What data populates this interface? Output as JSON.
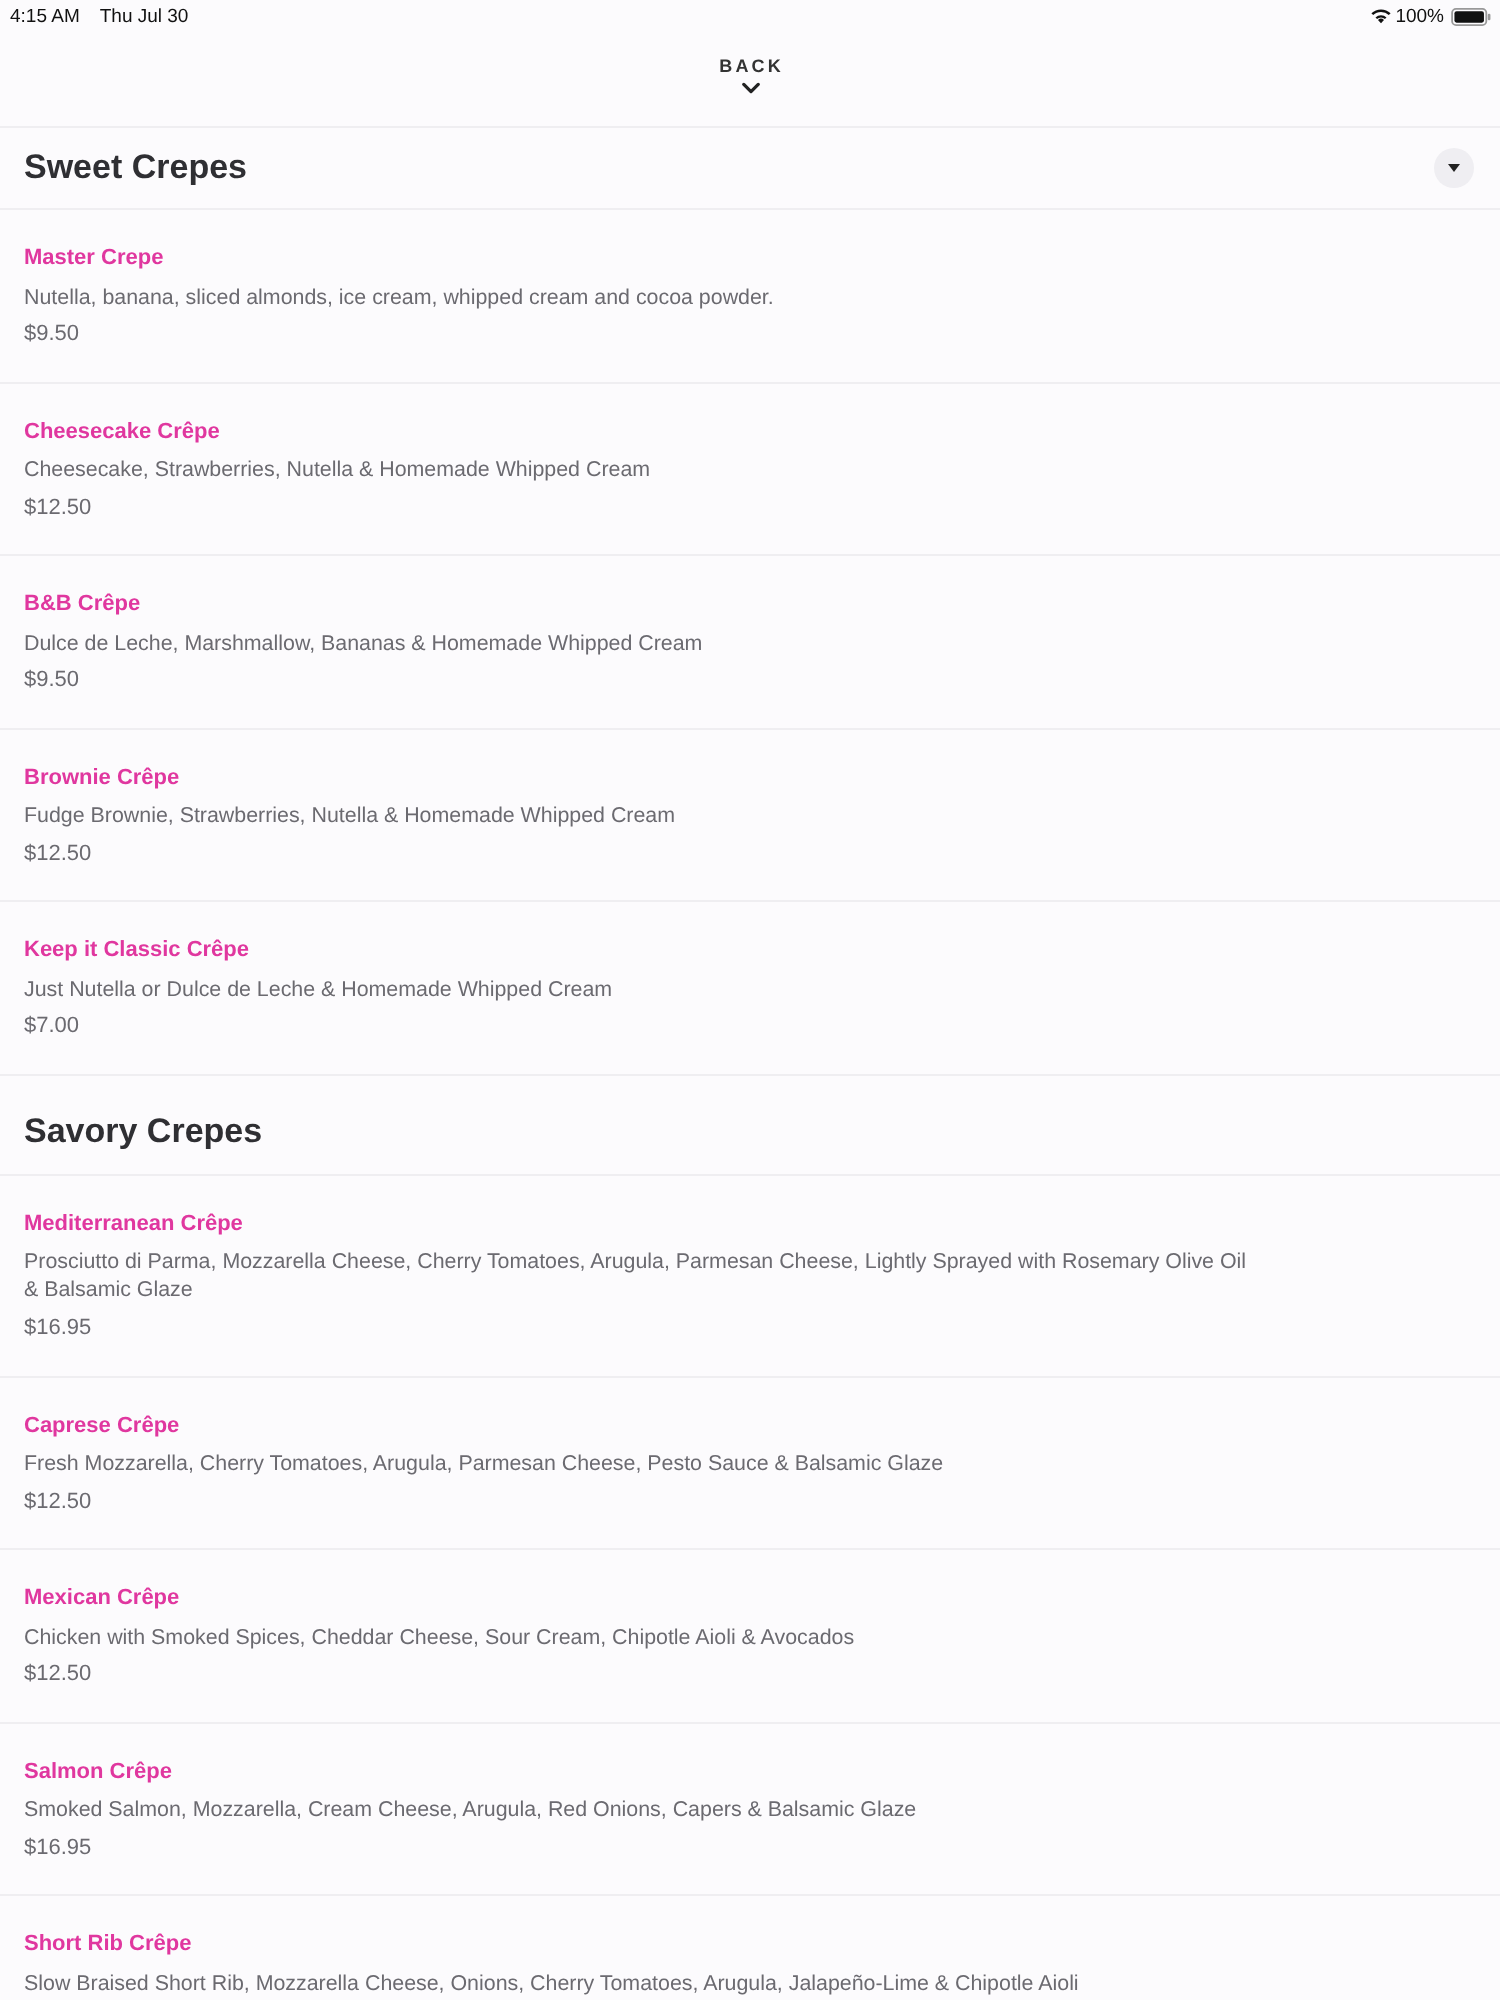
{
  "status_bar": {
    "time": "4:15 AM",
    "date": "Thu Jul 30",
    "battery": "100%"
  },
  "nav": {
    "back_label": "BACK"
  },
  "sections": [
    {
      "title": "Sweet Crepes",
      "toggle": true,
      "items": [
        {
          "name": "Master Crepe",
          "description": "Nutella, banana, sliced almonds, ice cream, whipped cream and cocoa powder.",
          "price": "$9.50"
        },
        {
          "name": "Cheesecake Crêpe",
          "description": "Cheesecake, Strawberries, Nutella & Homemade Whipped Cream",
          "price": "$12.50"
        },
        {
          "name": "B&B Crêpe",
          "description": "Dulce de Leche, Marshmallow, Bananas & Homemade Whipped Cream",
          "price": "$9.50"
        },
        {
          "name": "Brownie Crêpe",
          "description": "Fudge Brownie, Strawberries, Nutella & Homemade Whipped Cream",
          "price": "$12.50"
        },
        {
          "name": "Keep it Classic Crêpe",
          "description": "Just Nutella or Dulce de Leche & Homemade Whipped Cream",
          "price": "$7.00"
        }
      ]
    },
    {
      "title": "Savory Crepes",
      "toggle": false,
      "items": [
        {
          "name": "Mediterranean Crêpe",
          "description": "Prosciutto di Parma, Mozzarella Cheese, Cherry Tomatoes, Arugula, Parmesan Cheese, Lightly Sprayed with Rosemary Olive Oil & Balsamic Glaze",
          "price": "$16.95"
        },
        {
          "name": "Caprese Crêpe",
          "description": "Fresh Mozzarella, Cherry Tomatoes, Arugula, Parmesan Cheese, Pesto Sauce & Balsamic Glaze",
          "price": "$12.50"
        },
        {
          "name": "Mexican Crêpe",
          "description": "Chicken with Smoked Spices, Cheddar Cheese, Sour Cream, Chipotle Aioli & Avocados",
          "price": "$12.50"
        },
        {
          "name": "Salmon Crêpe",
          "description": "Smoked Salmon, Mozzarella, Cream Cheese, Arugula, Red Onions, Capers & Balsamic Glaze",
          "price": "$16.95"
        },
        {
          "name": "Short Rib Crêpe",
          "description": "Slow Braised Short Rib, Mozzarella Cheese, Onions, Cherry Tomatoes, Arugula, Jalapeño-Lime & Chipotle Aioli"
        }
      ]
    }
  ]
}
